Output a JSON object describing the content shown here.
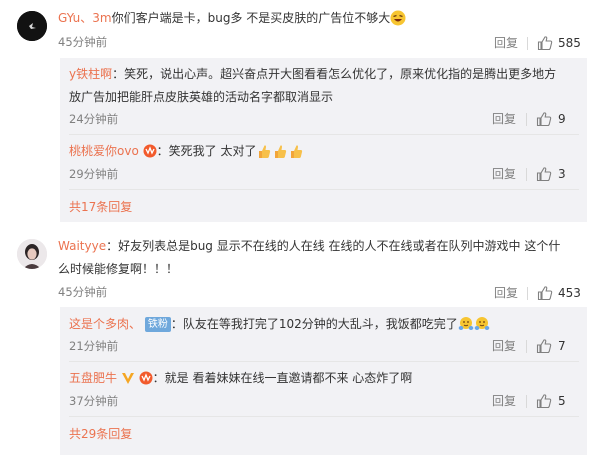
{
  "comments": [
    {
      "user": "GYu、3m",
      "text": "你们客户端是卡，bug多 不是买皮肤的广告位不够大",
      "time": "45分钟前",
      "reply_label": "回复",
      "likes": "585",
      "replies": [
        {
          "user": "y铁柱啊",
          "text_line1": "：笑死，说出心声。超兴奋点开大图看看怎么优化了，原来优化指的是腾出更多地方",
          "text_line2": "放广告加把能肝点皮肤英雄的活动名字都取消显示",
          "time": "24分钟前",
          "reply_label": "回复",
          "likes": "9"
        },
        {
          "user": "桃桃爱你ovo",
          "text": "：笑死我了 太对了",
          "time": "29分钟前",
          "reply_label": "回复",
          "likes": "3"
        }
      ],
      "more_replies": "共17条回复"
    },
    {
      "user": "Waityye",
      "text_line1": "：好友列表总是bug 显示不在线的人在线 在线的人不在线或者在队列中游戏中 这个什",
      "text_line2": "么时候能修复啊！！！",
      "time": "45分钟前",
      "reply_label": "回复",
      "likes": "453",
      "replies": [
        {
          "user": "这是个多肉、",
          "badge": "铁粉",
          "text": "：队友在等我打完了102分钟的大乱斗，我饭都吃完了",
          "time": "21分钟前",
          "reply_label": "回复",
          "likes": "7"
        },
        {
          "user": "五盘肥牛",
          "text": "：就是 看着妹妹在线一直邀请都不来 心态炸了啊",
          "time": "37分钟前",
          "reply_label": "回复",
          "likes": "5"
        }
      ],
      "more_replies": "共29条回复"
    }
  ],
  "colors": {
    "username": "#eb7350",
    "text": "#333333",
    "meta": "#808080",
    "reply_bg": "#f2f2f5"
  },
  "icons": {
    "like": "thumbs-up-icon",
    "laugh": "laughing-emoji-icon",
    "thumb": "thumbs-up-emoji-icon",
    "hug": "hug-emoji-icon",
    "vip": "vip-badge-icon"
  }
}
